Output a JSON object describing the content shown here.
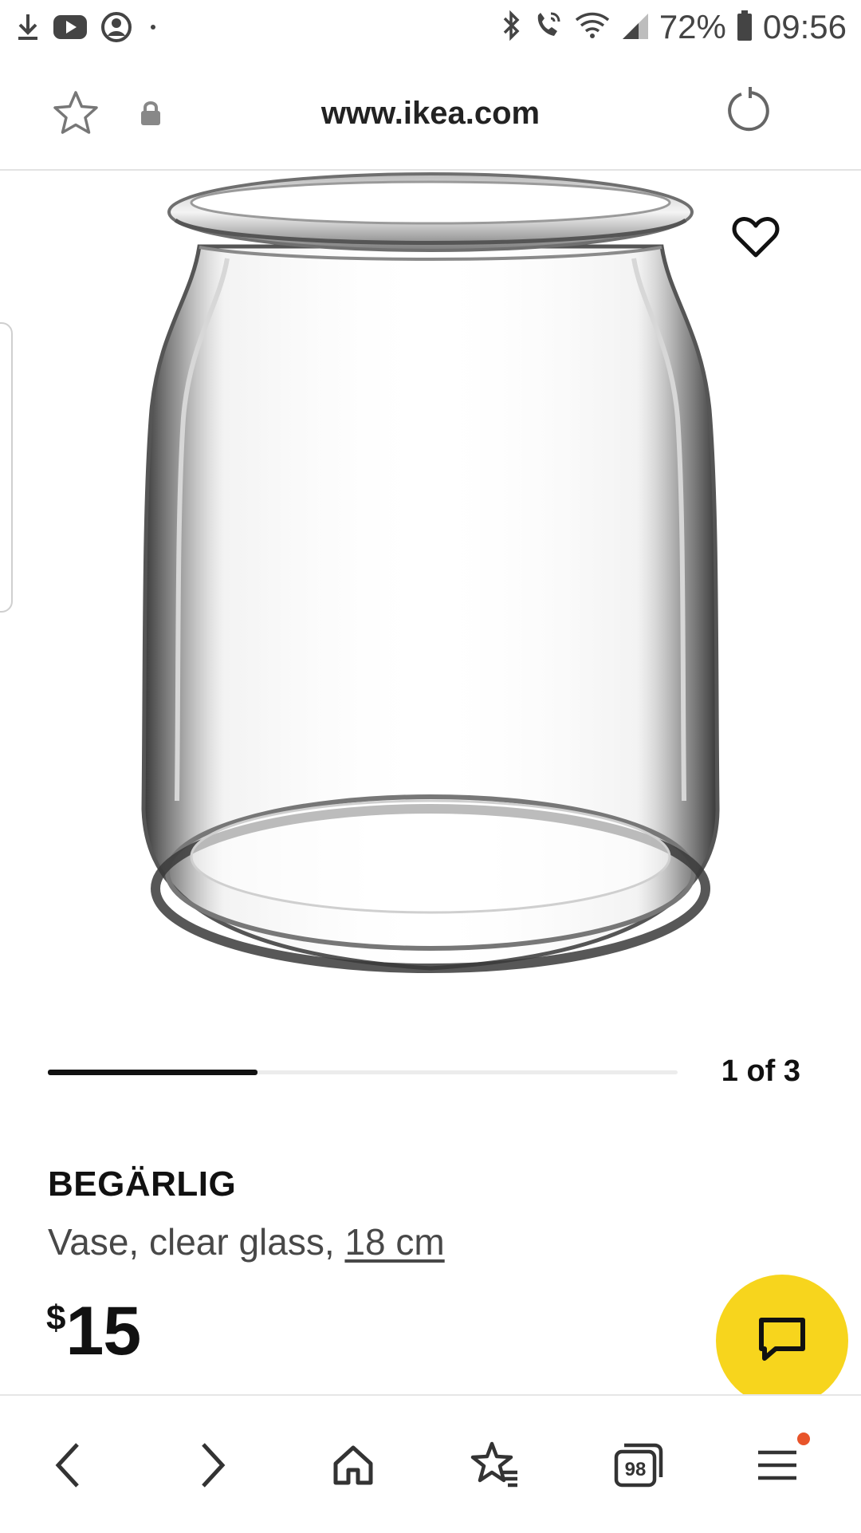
{
  "status_bar": {
    "battery": "72%",
    "time": "09:56",
    "icons": [
      "download-icon",
      "youtube-icon",
      "account-icon",
      "notification-dot-icon",
      "bluetooth-icon",
      "wifi-call-icon",
      "wifi-icon",
      "signal-icon",
      "battery-icon"
    ]
  },
  "browser": {
    "url": "www.ikea.com",
    "icons": [
      "star-icon",
      "lock-icon",
      "reload-icon"
    ]
  },
  "gallery": {
    "position_label": "1 of 3",
    "current": 1,
    "total": 3,
    "progress_fraction": 0.333
  },
  "product": {
    "name": "BEGÄRLIG",
    "description": "Vase, clear glass, ",
    "size": "18 cm",
    "price_currency": "$",
    "price_amount": "15"
  },
  "colors": {
    "chat_button": "#f7d51d",
    "notification_dot": "#e8542a",
    "text": "#111111"
  },
  "bottom_nav": {
    "tabs_count": "98",
    "items": [
      "back-icon",
      "forward-icon",
      "home-icon",
      "bookmarks-icon",
      "tabs-icon",
      "menu-icon"
    ]
  }
}
